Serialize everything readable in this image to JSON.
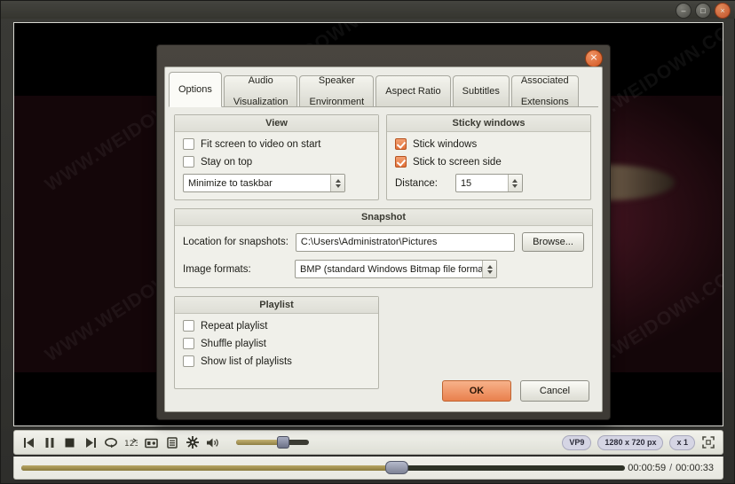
{
  "window": {
    "buttons": [
      {
        "name": "minimize",
        "glyph": "–"
      },
      {
        "name": "maximize",
        "glyph": "□"
      },
      {
        "name": "close",
        "glyph": "×"
      }
    ]
  },
  "video": {
    "watermark": "WWW.WEIDOWN.COM"
  },
  "controls": {
    "icons": [
      {
        "name": "previous-track-icon",
        "title": "Previous"
      },
      {
        "name": "pause-icon",
        "title": "Pause"
      },
      {
        "name": "stop-icon",
        "title": "Stop"
      },
      {
        "name": "next-track-icon",
        "title": "Next"
      },
      {
        "name": "repeat-icon",
        "title": "Repeat"
      },
      {
        "name": "playlist-order-icon",
        "title": "Playlist order"
      },
      {
        "name": "snapshot-icon",
        "title": "Snapshot"
      },
      {
        "name": "playlist-icon",
        "title": "Playlist"
      },
      {
        "name": "settings-icon",
        "title": "Settings"
      },
      {
        "name": "volume-icon",
        "title": "Volume"
      }
    ],
    "volume_percent": 63,
    "badges": [
      "VP9",
      "1280 x 720 px",
      "x 1"
    ],
    "fullscreen_icon": "fullscreen-icon",
    "seek_percent": 62,
    "time_current": "00:00:59",
    "time_separator": "/",
    "time_total": "00:00:33"
  },
  "dialog": {
    "close_glyph": "×",
    "tabs": [
      {
        "label": "Options",
        "lines": [
          "Options"
        ],
        "active": true
      },
      {
        "label": "Audio Visualization",
        "lines": [
          "Audio",
          "Visualization"
        ],
        "active": false
      },
      {
        "label": "Speaker Environment",
        "lines": [
          "Speaker",
          "Environment"
        ],
        "active": false
      },
      {
        "label": "Aspect Ratio",
        "lines": [
          "Aspect Ratio"
        ],
        "active": false
      },
      {
        "label": "Subtitles",
        "lines": [
          "Subtitles"
        ],
        "active": false
      },
      {
        "label": "Associated Extensions",
        "lines": [
          "Associated",
          "Extensions"
        ],
        "active": false
      }
    ],
    "view": {
      "title": "View",
      "checkboxes": [
        {
          "label": "Fit screen to video on start",
          "checked": false
        },
        {
          "label": "Stay on top",
          "checked": false
        }
      ],
      "minimize_select": {
        "value": "Minimize to taskbar"
      }
    },
    "sticky": {
      "title": "Sticky windows",
      "checkboxes": [
        {
          "label": "Stick windows",
          "checked": true
        },
        {
          "label": "Stick to screen side",
          "checked": true
        }
      ],
      "distance_label": "Distance:",
      "distance_value": "15"
    },
    "snapshot": {
      "title": "Snapshot",
      "location_label": "Location for snapshots:",
      "location_value": "C:\\Users\\Administrator\\Pictures",
      "browse_label": "Browse...",
      "format_label": "Image formats:",
      "format_value": "BMP (standard Windows Bitmap file format)"
    },
    "playlist": {
      "title": "Playlist",
      "checkboxes": [
        {
          "label": "Repeat playlist",
          "checked": false
        },
        {
          "label": "Shuffle playlist",
          "checked": false
        },
        {
          "label": "Show list of playlists",
          "checked": false
        }
      ]
    },
    "ok_label": "OK",
    "cancel_label": "Cancel"
  },
  "colors": {
    "accent_orange": "#e9804d",
    "checkbox_orange": "#e2713a",
    "slider_gold": "#8a7a3d",
    "badge_bg": "#d5d5e4"
  }
}
